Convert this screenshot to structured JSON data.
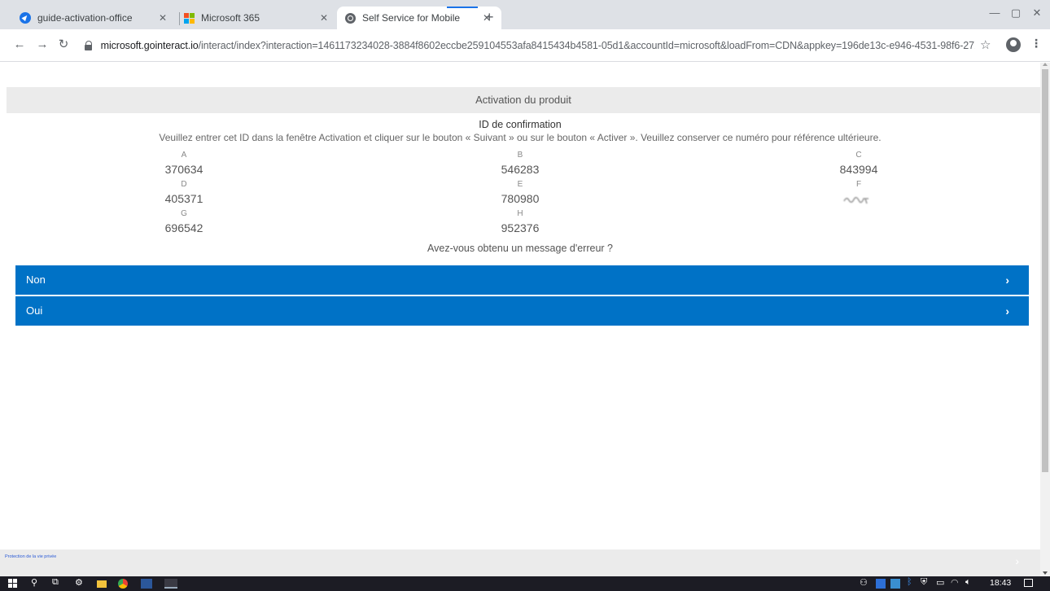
{
  "browser": {
    "tabs": [
      {
        "title": "guide-activation-office",
        "active": false
      },
      {
        "title": "Microsoft 365",
        "active": false
      },
      {
        "title": "Self Service for Mobile",
        "active": true
      }
    ],
    "url_host": "microsoft.gointeract.io",
    "url_rest": "/interact/index?interaction=1461173234028-3884f8602eccbe259104553afa8415434b4581-05d1&accountId=microsoft&loadFrom=CDN&appkey=196de13c-e946-4531-98f6-2719ec8..."
  },
  "page": {
    "header": "Activation du produit",
    "confirm_title": "ID de confirmation",
    "instructions": "Veuillez entrer cet ID dans la fenêtre Activation et cliquer sur le bouton « Suivant » ou sur le bouton « Activer ». Veuillez conserver ce numéro pour référence ultérieure.",
    "ids": {
      "A": "370634",
      "B": "546283",
      "C": "843994",
      "D": "405371",
      "E": "780980",
      "F": "",
      "G": "696542",
      "H": "952376"
    },
    "letters": {
      "A": "A",
      "B": "B",
      "C": "C",
      "D": "D",
      "E": "E",
      "F": "F",
      "G": "G",
      "H": "H"
    },
    "error_question": "Avez-vous obtenu un message d'erreur ?",
    "choices": {
      "no": "Non",
      "yes": "Oui"
    },
    "footer_link": "Protection de la vie privée"
  },
  "taskbar": {
    "clock": "18:43"
  },
  "colors": {
    "accent": "#0072c6",
    "header_bg": "#ebebeb",
    "tabstrip": "#dee1e6"
  }
}
